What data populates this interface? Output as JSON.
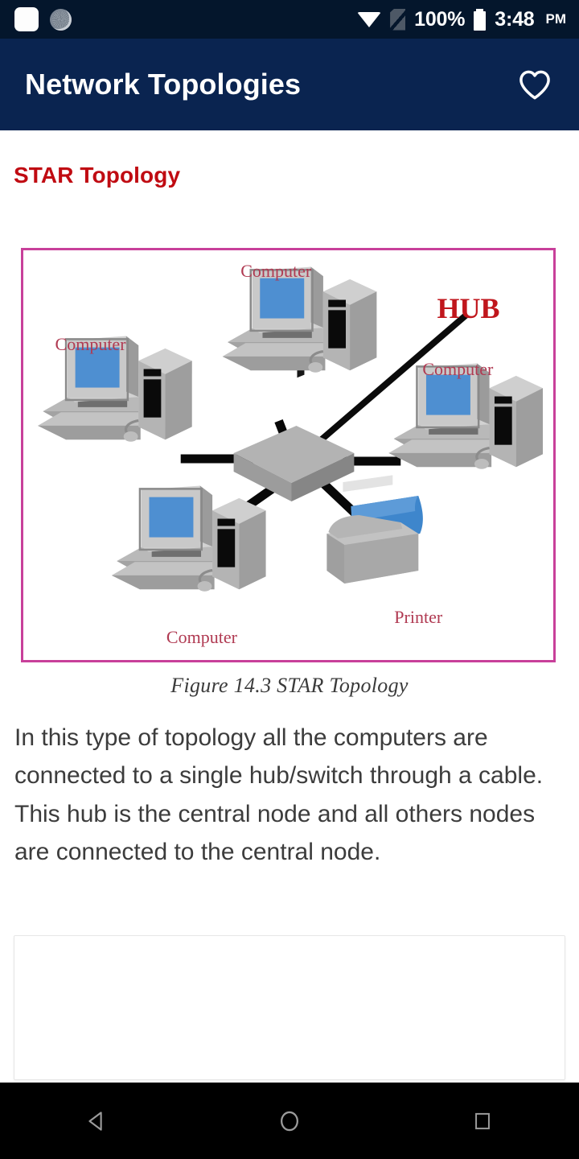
{
  "status_bar": {
    "notification_icons": [
      "app-notification-icon",
      "sync-progress-icon"
    ],
    "wifi_icon": "wifi-icon",
    "sim_icon": "no-sim-icon",
    "battery_percent": "100%",
    "battery_icon": "battery-full-icon",
    "time": "3:48",
    "period": "PM"
  },
  "app_bar": {
    "title": "Network Topologies",
    "favorite_icon": "heart-outline-icon"
  },
  "content": {
    "section_title": "STAR Topology",
    "figure": {
      "caption": "Figure 14.3 STAR Topology",
      "border_color": "#C8409A",
      "labels": {
        "top_computer": "Computer",
        "left_computer": "Computer",
        "right_computer": "Computer",
        "bottom_computer": "Computer",
        "hub": "HUB",
        "printer": "Printer"
      }
    },
    "paragraph": "In this type of topology all the computers are connected to a single hub/switch through a cable. This hub is the central node and all others nodes are connected to the central node.",
    "ad_placeholder": ""
  },
  "nav_bar": {
    "back_icon": "back-triangle-icon",
    "home_icon": "home-circle-icon",
    "recents_icon": "recents-square-icon"
  },
  "colors": {
    "status_bar_bg": "#04162C",
    "app_bar_bg": "#0A2450",
    "accent_red": "#C00B12",
    "figure_border": "#C8409A",
    "label_red": "#B03A52",
    "screen_blue": "#4E8FD1"
  }
}
